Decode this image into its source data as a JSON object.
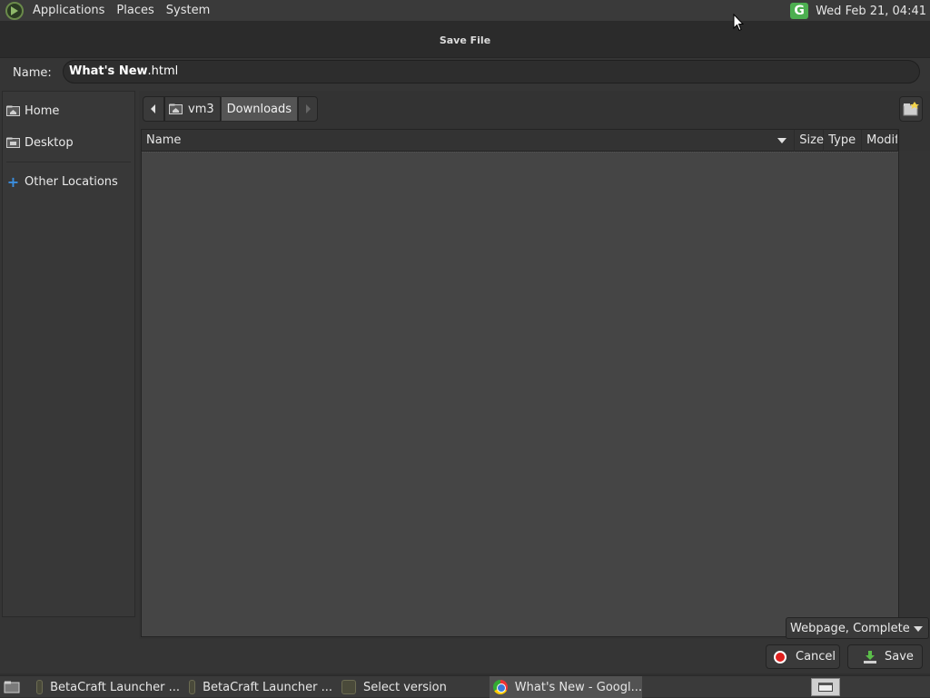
{
  "top_panel": {
    "menus": [
      "Applications",
      "Places",
      "System"
    ],
    "clock": "Wed Feb 21, 04:41",
    "tray_icon": "G"
  },
  "dialog": {
    "title": "Save File",
    "name_label": "Name:",
    "name_value_selected": "What's New",
    "name_value_ext": ".html"
  },
  "sidebar": {
    "items": [
      {
        "label": "Home",
        "icon": "home-folder-icon"
      },
      {
        "label": "Desktop",
        "icon": "desktop-folder-icon"
      },
      {
        "label": "Other Locations",
        "icon": "plus-icon"
      }
    ]
  },
  "pathbar": {
    "segments": [
      "vm3",
      "Downloads"
    ]
  },
  "file_list": {
    "columns": [
      "Name",
      "Size",
      "Type",
      "Modif"
    ]
  },
  "filter": {
    "selected": "Webpage, Complete"
  },
  "buttons": {
    "cancel": "Cancel",
    "save": "Save"
  },
  "taskbar": {
    "tasks": [
      {
        "label": "BetaCraft Launcher ...",
        "active": false
      },
      {
        "label": "BetaCraft Launcher ...",
        "active": false
      },
      {
        "label": "Select version",
        "active": false
      },
      {
        "label": "What's New - Googl...",
        "active": true
      }
    ]
  },
  "colors": {
    "accent_blue": "#3b8fe0",
    "cancel_red": "#e0201e",
    "tray_green": "#4caf50"
  }
}
